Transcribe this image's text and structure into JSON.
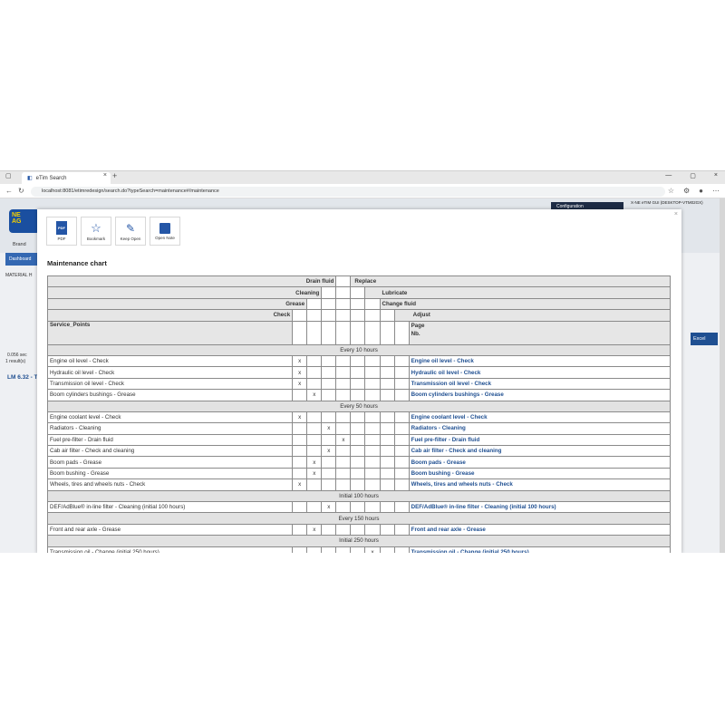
{
  "browser": {
    "tab_title": "eTim Search",
    "url": "localhost:8081/etimredesign/search.do?typeSearch=maintenance#/maintenance"
  },
  "app": {
    "logo_text": "NE",
    "logo_sub": "AG",
    "brand_label": "Brand",
    "dashboard_tab": "Dashboard",
    "material_label": "MATERIAL H",
    "time_label": "0.056 sec",
    "result_label": "1 result(s)",
    "lm_label": "LM 6.32 - T",
    "config_label": "Configuration",
    "user_label": "X-NE eTIM GUI (DESKTOP-VTM02GX)",
    "excel_label": "Excel"
  },
  "toolbar": {
    "pdf_label": "PDF",
    "pdf_icon_text": "PDF",
    "bookmark_label": "Bookmark",
    "keep_open_label": "Keep Open",
    "open_note_label": "Open Note"
  },
  "chart": {
    "title": "Maintenance chart",
    "headers": {
      "drain_fluid": "Drain fluid",
      "replace": "Replace",
      "cleaning": "Cleaning",
      "lubricate": "Lubricate",
      "grease": "Grease",
      "change_fluid": "Change fluid",
      "check": "Check",
      "adjust": "Adjust",
      "service_points": "Service_Points",
      "page": "Page",
      "nb": "Nb."
    },
    "sections": [
      {
        "label": "Every 10 hours",
        "rows": [
          {
            "name": "Engine oil level - Check",
            "mark_col": 0,
            "link": "Engine oil level - Check"
          },
          {
            "name": "Hydraulic oil level - Check",
            "mark_col": 0,
            "link": "Hydraulic oil level - Check"
          },
          {
            "name": "Transmission oil level - Check",
            "mark_col": 0,
            "link": "Transmission oil level - Check"
          },
          {
            "name": "Boom cylinders bushings - Grease",
            "mark_col": 1,
            "link": "Boom cylinders bushings - Grease"
          }
        ]
      },
      {
        "label": "Every 50 hours",
        "rows": [
          {
            "name": "Engine coolant level - Check",
            "mark_col": 0,
            "link": "Engine coolant level - Check"
          },
          {
            "name": "Radiators - Cleaning",
            "mark_col": 2,
            "link": "Radiators - Cleaning"
          },
          {
            "name": "Fuel pre-filter - Drain fluid",
            "mark_col": 3,
            "link": "Fuel pre-filter - Drain fluid"
          },
          {
            "name": "Cab air filter - Check and cleaning",
            "mark_col": 2,
            "link": "Cab air filter - Check and cleaning"
          },
          {
            "name": "Boom pads - Grease",
            "mark_col": 1,
            "link": "Boom pads - Grease"
          },
          {
            "name": "Boom bushing - Grease",
            "mark_col": 1,
            "link": "Boom bushing - Grease"
          },
          {
            "name": "Wheels, tires and wheels nuts - Check",
            "mark_col": 0,
            "link": "Wheels, tires and wheels nuts - Check"
          }
        ]
      },
      {
        "label": "Initial 100 hours",
        "rows": [
          {
            "name": "DEF/AdBlue® in-line filter - Cleaning (initial 100 hours)",
            "mark_col": 2,
            "link": "DEF/AdBlue® in-line filter - Cleaning (initial 100 hours)"
          }
        ]
      },
      {
        "label": "Every 150 hours",
        "rows": [
          {
            "name": "Front and rear axle - Grease",
            "mark_col": 1,
            "link": "Front and rear axle - Grease"
          }
        ]
      },
      {
        "label": "Initial 250 hours",
        "rows": [
          {
            "name": "Transmission oil - Change (initial 250 hours)",
            "mark_col": 5,
            "link": "Transmission oil - Change (initial 250 hours)"
          }
        ]
      }
    ],
    "mark_text": "x"
  }
}
